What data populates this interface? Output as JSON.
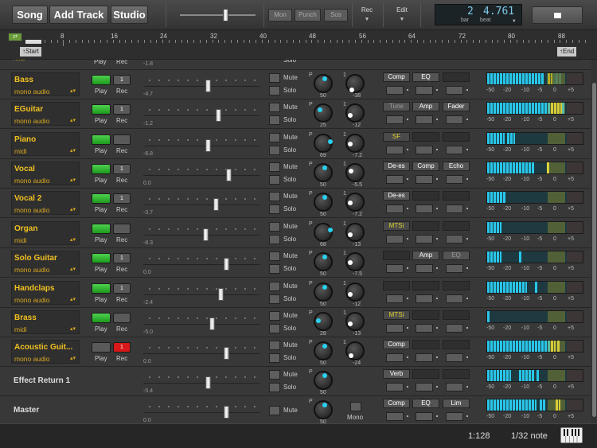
{
  "toolbar": {
    "song": "Song",
    "add_track": "Add Track",
    "studio": "Studio",
    "mon": "Mon",
    "punch": "Punch",
    "sos": "Sos",
    "rec_menu": "Rec",
    "edit_menu": "Edit",
    "lcd_bar": "2",
    "lcd_beat": "4.761",
    "lcd_bar_label": "bar",
    "lcd_beat_label": "beat"
  },
  "ruler": {
    "ticks": [
      "8",
      "16",
      "24",
      "32",
      "40",
      "48",
      "56",
      "64",
      "72",
      "80",
      "88"
    ],
    "start": "Start",
    "end": "End"
  },
  "labels": {
    "play": "Play",
    "rec": "Rec",
    "mute": "Mute",
    "solo": "Solo",
    "mono": "Mono",
    "pan_p": "P",
    "vol_1": "1"
  },
  "meter_scale": [
    "-50",
    "-20",
    "-10",
    "-5",
    "0",
    "+5"
  ],
  "partial_top": {
    "type": "midi",
    "fader_value": "-1.8",
    "pan_value": "50",
    "vol_value": "-30"
  },
  "tracks": [
    {
      "name": "Bass",
      "type": "mono audio",
      "fader_value": "-4.7",
      "pan_value": "50",
      "vol_value": "-38",
      "fx": [
        "Comp",
        "EQ",
        ""
      ],
      "play_on": true,
      "rec_label": "1",
      "rec_armed": false
    },
    {
      "name": "EGuitar",
      "type": "mono audio",
      "fader_value": "-1.2",
      "pan_value": "25",
      "vol_value": "-12",
      "fx": [
        "Tune",
        "Amp",
        "Fader"
      ],
      "play_on": true,
      "rec_label": "1",
      "rec_armed": false
    },
    {
      "name": "Piano",
      "type": "midi",
      "fader_value": "-6.8",
      "pan_value": "69",
      "vol_value": "-7.2",
      "fx": [
        "SF",
        "",
        ""
      ],
      "play_on": true,
      "rec_label": "",
      "rec_armed": false
    },
    {
      "name": "Vocal",
      "type": "mono audio",
      "fader_value": "0.0",
      "pan_value": "50",
      "vol_value": "-5.5",
      "fx": [
        "De-es",
        "Comp",
        "Echo"
      ],
      "play_on": true,
      "rec_label": "1",
      "rec_armed": false
    },
    {
      "name": "Vocal 2",
      "type": "mono audio",
      "fader_value": "-3.7",
      "pan_value": "50",
      "vol_value": "-7.2",
      "fx": [
        "De-es",
        "",
        ""
      ],
      "play_on": true,
      "rec_label": "1",
      "rec_armed": false
    },
    {
      "name": "Organ",
      "type": "midi",
      "fader_value": "-8.3",
      "pan_value": "68",
      "vol_value": "-13",
      "fx": [
        "MTSi",
        "",
        ""
      ],
      "play_on": true,
      "rec_label": "",
      "rec_armed": false
    },
    {
      "name": "Solo Guitar",
      "type": "mono audio",
      "fader_value": "0.0",
      "pan_value": "50",
      "vol_value": "-7.5",
      "fx": [
        "",
        "Amp",
        "EQ"
      ],
      "play_on": true,
      "rec_label": "1",
      "rec_armed": false
    },
    {
      "name": "Handclaps",
      "type": "mono audio",
      "fader_value": "-2.4",
      "pan_value": "50",
      "vol_value": "-12",
      "fx": [
        "",
        "",
        ""
      ],
      "play_on": true,
      "rec_label": "1",
      "rec_armed": false
    },
    {
      "name": "Brass",
      "type": "midi",
      "fader_value": "-5.0",
      "pan_value": "28",
      "vol_value": "-13",
      "fx": [
        "MTSi",
        "",
        ""
      ],
      "play_on": true,
      "rec_label": "",
      "rec_armed": false
    },
    {
      "name": "Acoustic Guit...",
      "type": "mono audio",
      "fader_value": "0.0",
      "pan_value": "50",
      "vol_value": "-24",
      "fx": [
        "Comp",
        "",
        ""
      ],
      "play_on": false,
      "rec_label": "1",
      "rec_armed": true
    }
  ],
  "effect_return": {
    "name": "Effect Return 1",
    "fader_value": "-5.4",
    "pan_value": "50",
    "fx": [
      "Verb",
      "",
      ""
    ]
  },
  "master": {
    "name": "Master",
    "fader_value": "0.0",
    "pan_value": "50",
    "fx": [
      "Comp",
      "EQ",
      "Lim"
    ]
  },
  "status": {
    "grid": "1:128",
    "note": "1/32 note"
  }
}
